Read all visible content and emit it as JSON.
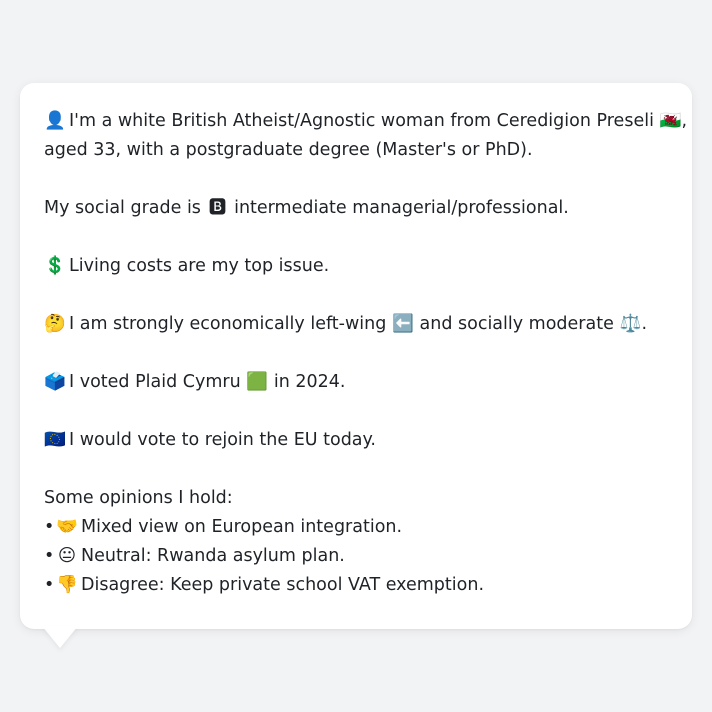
{
  "intro": {
    "icon": "👤",
    "text_a": "I'm a white British Atheist/Agnostic woman from Ceredigion Preseli",
    "flag": "🏴󠁧󠁢󠁷󠁬󠁳󠁿",
    "text_b": ",",
    "line2": "aged 33, with a postgraduate degree (Master's or PhD)."
  },
  "social_grade": {
    "prefix": "My social grade is",
    "badge": "🅱",
    "suffix": "intermediate managerial/professional."
  },
  "top_issue": {
    "icon": "💲",
    "text": "Living costs are my top issue."
  },
  "ideology": {
    "icon": "🤔",
    "text_a": "I am strongly economically left-wing",
    "icon_left": "⬅️",
    "text_b": "and socially moderate",
    "icon_scale": "⚖️",
    "text_c": "."
  },
  "vote": {
    "icon": "🗳️",
    "text_a": "I voted Plaid Cymru",
    "party_square": "🟩",
    "text_b": "in 2024."
  },
  "eu": {
    "icon": "🇪🇺",
    "text": "I would vote to rejoin the EU today."
  },
  "opinions": {
    "heading": "Some opinions I hold:",
    "bullet": "•",
    "items": [
      {
        "icon": "🤝",
        "text": "Mixed view on European integration."
      },
      {
        "icon": "😐",
        "text": "Neutral: Rwanda asylum plan."
      },
      {
        "icon": "👎",
        "text": "Disagree: Keep private school VAT exemption."
      }
    ]
  }
}
